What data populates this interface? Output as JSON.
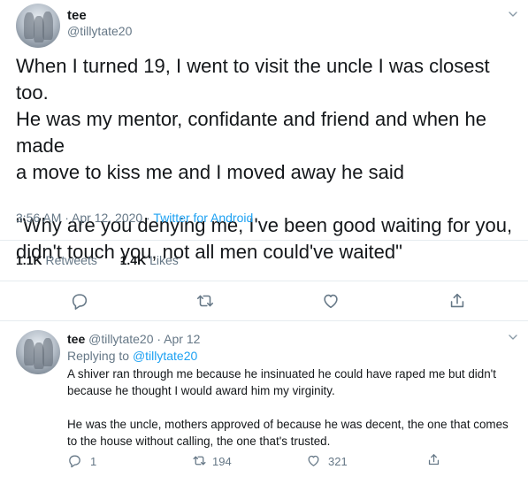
{
  "tweet": {
    "name": "tee",
    "handle": "@tillytate20",
    "text": "When I turned 19, I went to visit the uncle I was closest too.\nHe was my mentor, confidante and friend and when he made\na move to kiss me and I moved away he said\n\n\"Why are you denying me, I've been good waiting for you,\ndidn't touch you, not all men could've waited\"",
    "time": "3:56 AM · Apr 12, 2020",
    "separator": " · ",
    "source": "Twitter for Android",
    "retweets_count": "1.1K",
    "retweets_label": "Retweets",
    "likes_count": "1.4K",
    "likes_label": "Likes"
  },
  "reply": {
    "name": "tee",
    "handle_date": "@tillytate20 · Apr 12",
    "replying_prefix": "Replying to",
    "replying_to": "@tillytate20",
    "paragraphs": [
      "A shiver ran through me because he insinuated he could have raped me but didn't because he thought I would award him my virginity.",
      "He was the uncle, mothers approved of because he was decent, the one that comes to the house without calling, the one that's trusted."
    ],
    "reply_count": "1",
    "retweet_count": "194",
    "like_count": "321"
  },
  "colors": {
    "text": "#14171a",
    "secondary": "#657786",
    "accent": "#1da1f2",
    "divider": "#e6ecf0"
  },
  "icons": [
    "chevron-down-icon",
    "reply-icon",
    "retweet-icon",
    "like-icon",
    "share-icon"
  ]
}
